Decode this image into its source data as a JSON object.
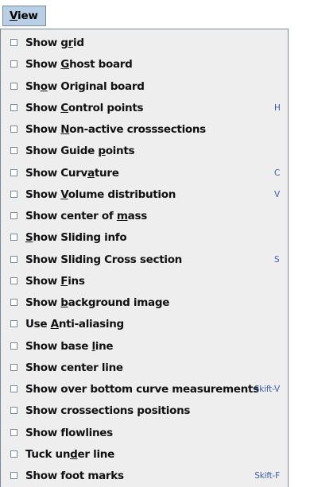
{
  "menu": {
    "title": "View",
    "mnemonic": "V"
  },
  "items": [
    {
      "label": "Show grid",
      "mnemonic_index": 6,
      "accelerator": ""
    },
    {
      "label": "Show Ghost board",
      "mnemonic_index": 5,
      "accelerator": ""
    },
    {
      "label": "Show Original board",
      "mnemonic_index": 2,
      "accelerator": ""
    },
    {
      "label": "Show Control points",
      "mnemonic_index": 5,
      "accelerator": "H"
    },
    {
      "label": "Show Non-active crosssections",
      "mnemonic_index": 5,
      "accelerator": ""
    },
    {
      "label": "Show Guide points",
      "mnemonic_index": 11,
      "accelerator": ""
    },
    {
      "label": "Show Curvature",
      "mnemonic_index": 9,
      "accelerator": "C"
    },
    {
      "label": "Show Volume distribution",
      "mnemonic_index": 5,
      "accelerator": "V"
    },
    {
      "label": "Show center of mass",
      "mnemonic_index": 15,
      "accelerator": ""
    },
    {
      "label": "Show Sliding info",
      "mnemonic_index": 0,
      "accelerator": ""
    },
    {
      "label": "Show Sliding Cross section",
      "mnemonic_index": -1,
      "accelerator": "S"
    },
    {
      "label": "Show Fins",
      "mnemonic_index": 5,
      "accelerator": ""
    },
    {
      "label": "Show background image",
      "mnemonic_index": 5,
      "accelerator": ""
    },
    {
      "label": "Use Anti-aliasing",
      "mnemonic_index": 4,
      "accelerator": ""
    },
    {
      "label": "Show base line",
      "mnemonic_index": 10,
      "accelerator": ""
    },
    {
      "label": "Show center line",
      "mnemonic_index": -1,
      "accelerator": ""
    },
    {
      "label": "Show over bottom curve measurements",
      "mnemonic_index": -1,
      "accelerator": "Skift-V"
    },
    {
      "label": "Show crossections positions",
      "mnemonic_index": -1,
      "accelerator": ""
    },
    {
      "label": "Show flowlines",
      "mnemonic_index": -1,
      "accelerator": ""
    },
    {
      "label": "Tuck under line",
      "mnemonic_index": 7,
      "accelerator": ""
    },
    {
      "label": "Show foot marks",
      "mnemonic_index": -1,
      "accelerator": "Skift-F"
    }
  ],
  "colors": {
    "menu_title_bg": "#b8cfe5",
    "popup_bg": "#eeeeee",
    "border": "#7a8a99",
    "accelerator": "#3a5fa8"
  }
}
